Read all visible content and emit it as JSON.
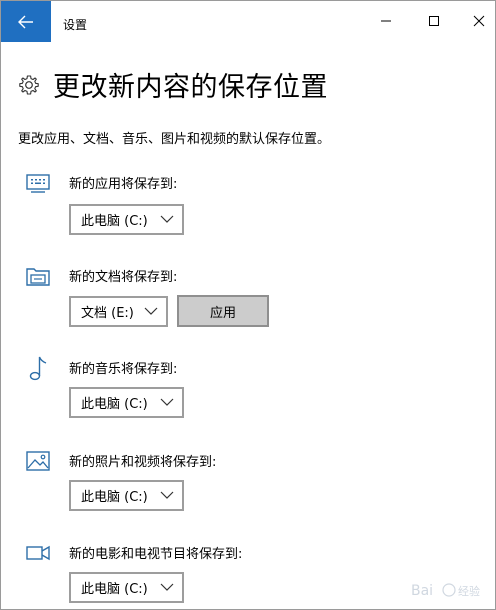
{
  "window": {
    "title": "设置"
  },
  "header": {
    "title": "更改新内容的保存位置",
    "description": "更改应用、文档、音乐、图片和视频的默认保存位置。"
  },
  "sections": [
    {
      "label": "新的应用将保存到:",
      "value": "此电脑 (C:)",
      "icon": "monitor-icon"
    },
    {
      "label": "新的文档将保存到:",
      "value": "文档 (E:)",
      "icon": "documents-drive-icon",
      "apply_label": "应用"
    },
    {
      "label": "新的音乐将保存到:",
      "value": "此电脑 (C:)",
      "icon": "music-note-icon"
    },
    {
      "label": "新的照片和视频将保存到:",
      "value": "此电脑 (C:)",
      "icon": "picture-icon"
    },
    {
      "label": "新的电影和电视节目将保存到:",
      "value": "此电脑 (C:)",
      "icon": "video-camera-icon"
    }
  ],
  "colors": {
    "accent": "#1f6fc1",
    "icon": "#2d6ea8",
    "button_bg": "#cccccc"
  }
}
